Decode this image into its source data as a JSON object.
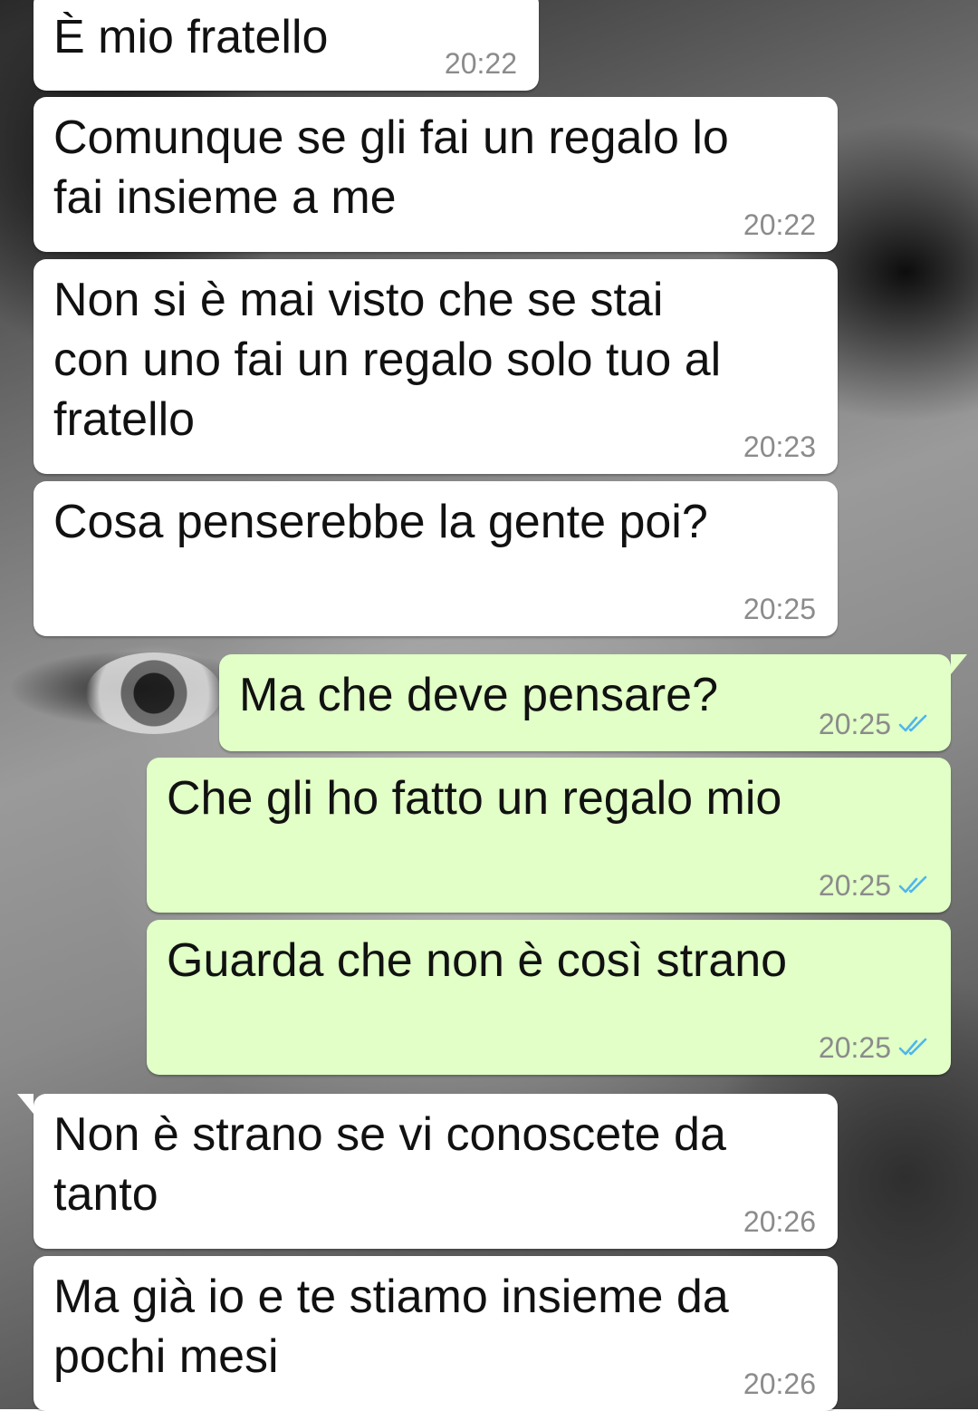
{
  "colors": {
    "incoming_bubble": "#ffffff",
    "outgoing_bubble": "#e1ffc7",
    "time_text": "#8b8b8b",
    "read_ticks": "#4fb6ec"
  },
  "messages": [
    {
      "direction": "incoming",
      "text": "È mio fratello",
      "time": "20:22"
    },
    {
      "direction": "incoming",
      "text": "Comunque se gli fai un regalo lo\nfai insieme a me",
      "time": "20:22"
    },
    {
      "direction": "incoming",
      "text": "Non si è mai visto che se stai\ncon uno fai un regalo solo tuo al\nfratello",
      "time": "20:23"
    },
    {
      "direction": "incoming",
      "text": "Cosa penserebbe la gente poi?",
      "time": "20:25"
    },
    {
      "direction": "outgoing",
      "text": "Ma che deve pensare?",
      "time": "20:25",
      "status_icon": "double-check-read-icon"
    },
    {
      "direction": "outgoing",
      "text": "Che gli ho fatto un regalo mio",
      "time": "20:25",
      "status_icon": "double-check-read-icon"
    },
    {
      "direction": "outgoing",
      "text": "Guarda che non è così strano",
      "time": "20:25",
      "status_icon": "double-check-read-icon"
    },
    {
      "direction": "incoming",
      "text": "Non è strano se vi conoscete da\ntanto",
      "time": "20:26"
    },
    {
      "direction": "incoming",
      "text": "Ma già io e te stiamo insieme da\npochi mesi",
      "time": "20:26"
    }
  ]
}
